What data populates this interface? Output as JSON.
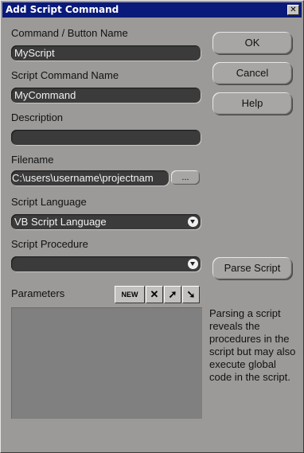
{
  "window": {
    "title": "Add Script Command",
    "close_label": "✕"
  },
  "fields": {
    "button_name": {
      "label": "Command / Button Name",
      "value": "MyScript"
    },
    "command_name": {
      "label": "Script Command Name",
      "value": "MyCommand"
    },
    "description": {
      "label": "Description",
      "value": ""
    },
    "filename": {
      "label": "Filename",
      "value": "C:\\users\\username\\projectnam",
      "browse_label": "..."
    },
    "language": {
      "label": "Script Language",
      "value": "VB Script Language"
    },
    "procedure": {
      "label": "Script Procedure",
      "value": ""
    }
  },
  "buttons": {
    "ok": "OK",
    "cancel": "Cancel",
    "help": "Help",
    "parse": "Parse Script"
  },
  "parameters": {
    "label": "Parameters",
    "new_label": "NEW",
    "delete_icon": "✕",
    "up_icon": "➚",
    "down_icon": "➘"
  },
  "info_text": "Parsing a script reveals the procedures in the script but may also execute global code in the script."
}
